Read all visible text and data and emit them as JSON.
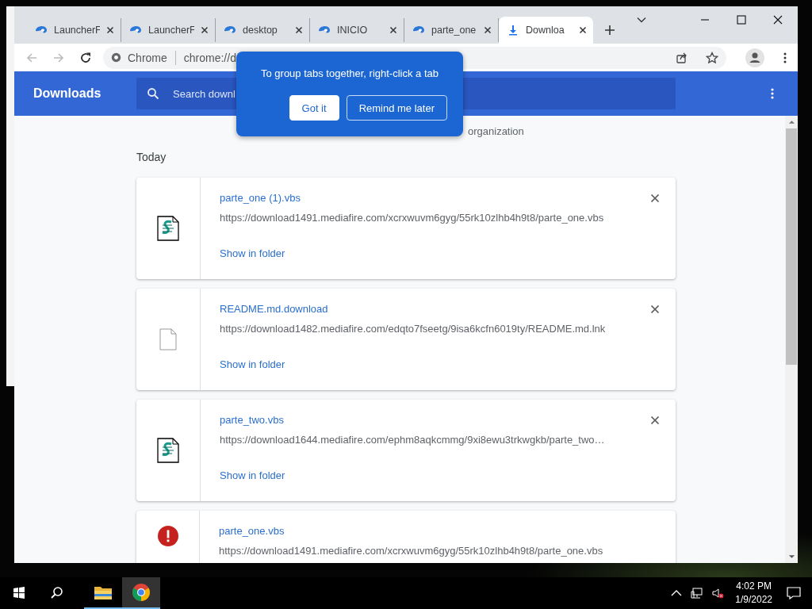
{
  "tabs": [
    {
      "title": "LauncherF",
      "kind": "swirl",
      "selected": false
    },
    {
      "title": "LauncherF",
      "kind": "swirl",
      "selected": false
    },
    {
      "title": "desktop",
      "kind": "swirl",
      "selected": false
    },
    {
      "title": "INICIO",
      "kind": "swirl",
      "selected": false
    },
    {
      "title": "parte_one",
      "kind": "swirl",
      "selected": false
    },
    {
      "title": "Downloa",
      "kind": "download",
      "selected": true
    }
  ],
  "toolbar": {
    "site_label": "Chrome",
    "url": "chrome://d"
  },
  "header": {
    "title": "Downloads",
    "search_placeholder": "Search downl"
  },
  "managed_notice": "organization",
  "section": "Today",
  "downloads": [
    {
      "filename": "parte_one (1).vbs",
      "url": "https://download1491.mediafire.com/xcrxwuvm6gyg/55rk10zlhb4h9t8/parte_one.vbs",
      "action": "Show in folder",
      "kind": "script",
      "removable": true
    },
    {
      "filename": "README.md.download",
      "url": "https://download1482.mediafire.com/edqto7fseetg/9isa6kcfn6019ty/README.md.lnk",
      "action": "Show in folder",
      "kind": "file",
      "removable": true
    },
    {
      "filename": "parte_two.vbs",
      "url": "https://download1644.mediafire.com/ephm8aqkcmmg/9xi8ewu3trkwgkb/parte_two…",
      "action": "Show in folder",
      "kind": "script",
      "removable": true
    },
    {
      "filename": "parte_one.vbs",
      "url": "https://download1491.mediafire.com/xcrxwuvm6gyg/55rk10zlhb4h9t8/parte_one.vbs",
      "kind": "error",
      "removable": false
    }
  ],
  "bubble": {
    "text": "To group tabs together, right-click a tab",
    "buttons": [
      {
        "label": "Got it",
        "primary": true
      },
      {
        "label": "Remind me later",
        "primary": false
      }
    ]
  },
  "taskbar": {
    "time": "4:02 PM",
    "date": "1/9/2022"
  }
}
